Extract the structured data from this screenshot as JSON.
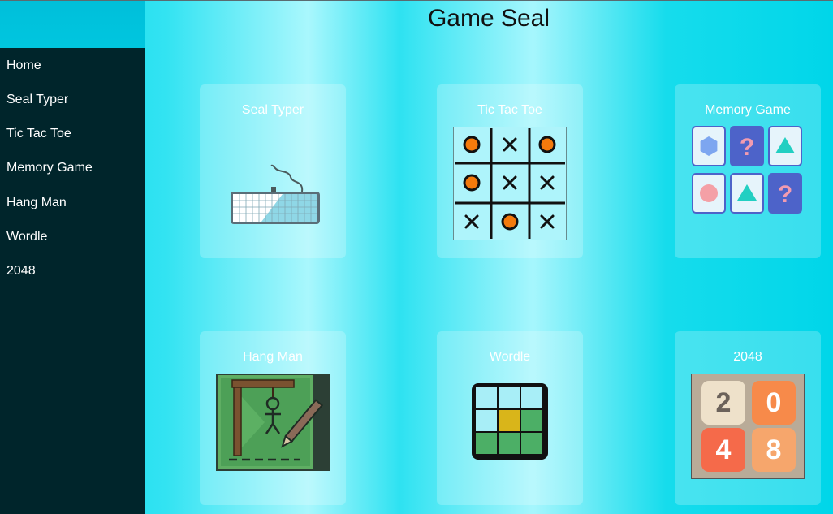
{
  "app": {
    "title": "Game Seal"
  },
  "sidebar": {
    "items": [
      {
        "label": "Home"
      },
      {
        "label": "Seal Typer"
      },
      {
        "label": "Tic Tac Toe"
      },
      {
        "label": "Memory Game"
      },
      {
        "label": "Hang Man"
      },
      {
        "label": "Wordle"
      },
      {
        "label": "2048"
      }
    ]
  },
  "games": [
    {
      "title": "Seal Typer",
      "icon": "keyboard-icon"
    },
    {
      "title": "Tic Tac Toe",
      "icon": "tic-tac-toe-icon",
      "board": [
        "O",
        "X",
        "O",
        "O",
        "X",
        "X",
        "X",
        "O",
        "X"
      ]
    },
    {
      "title": "Memory Game",
      "icon": "memory-cards-icon",
      "cards": [
        "hexagon",
        "?",
        "triangle",
        "circle",
        "triangle",
        "?"
      ]
    },
    {
      "title": "Hang Man",
      "icon": "hangman-icon"
    },
    {
      "title": "Wordle",
      "icon": "wordle-grid-icon"
    },
    {
      "title": "2048",
      "icon": "tiles-2048-icon",
      "tiles": [
        "2",
        "0",
        "4",
        "8"
      ]
    }
  ],
  "colors": {
    "sidebar_bg": "#00252b",
    "accent_cyan": "#00d8ea",
    "tic_o": "#f47a0c",
    "memory_card": "#4d63c9",
    "wordle_green": "#4caf66",
    "wordle_yellow": "#d9b51a"
  }
}
